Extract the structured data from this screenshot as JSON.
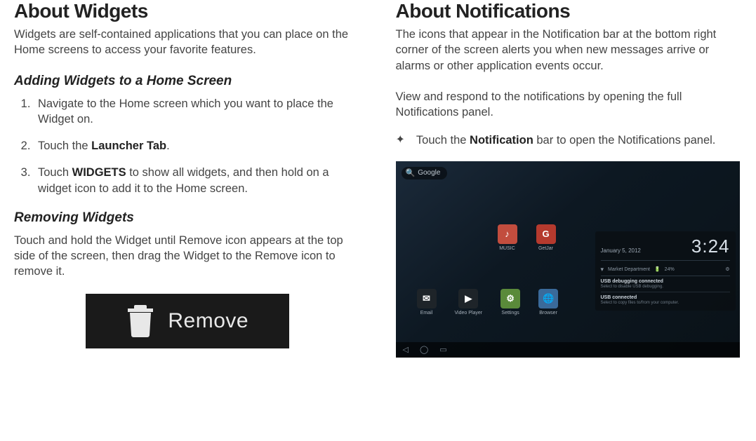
{
  "left": {
    "h1": "About Widgets",
    "intro": "Widgets are self-contained applications that you can place on the Home screens to access your favorite features.",
    "adding": {
      "h2": "Adding Widgets to a Home Screen",
      "steps": [
        {
          "pre": "Navigate to the Home screen which you want to place the Widget on."
        },
        {
          "pre": "Touch the ",
          "bold": "Launcher Tab",
          "post": "."
        },
        {
          "pre": "Touch ",
          "bold": "WIDGETS",
          "post": " to show all widgets, and then hold on a widget icon to add it to the Home screen."
        }
      ]
    },
    "removing": {
      "h2": "Removing Widgets",
      "para": "Touch and hold the Widget until Remove icon appears at the top side of the screen, then drag the Widget to the Remove icon to remove it.",
      "badge_label": "Remove"
    }
  },
  "right": {
    "h1": "About Notifications",
    "intro": "The icons that appear in the Notification bar at the bottom right corner of the screen alerts you when new messages arrive or alarms or other application events occur.",
    "para2": "View and respond to the notifications by opening the full Notifications panel.",
    "bullet": {
      "pre": "Touch the ",
      "bold": "Notification",
      "post": " bar to open the Notifications panel."
    },
    "tablet": {
      "search_label": "Google",
      "apps": {
        "email": "Email",
        "video": "Video Player",
        "settings": "Settings",
        "browser": "Browser",
        "music": "MUSIC",
        "gcap": "GetJar"
      },
      "panel": {
        "date": "January 5, 2012",
        "time": "3:24",
        "status": "Market Department",
        "pct": "24%",
        "notif1_title": "USB debugging connected",
        "notif1_sub": "Select to disable USB debugging.",
        "notif2_title": "USB connected",
        "notif2_sub": "Select to copy files to/from your computer."
      }
    }
  }
}
